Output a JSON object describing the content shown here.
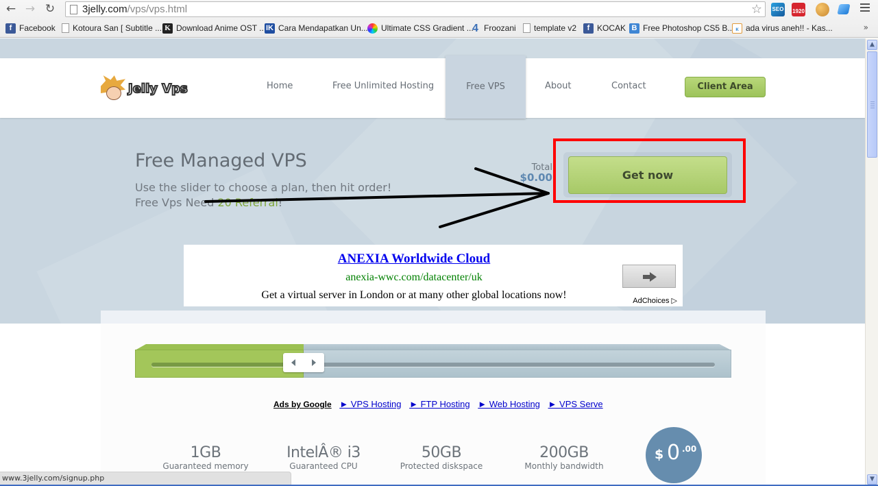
{
  "browser": {
    "url_host": "3jelly.com",
    "url_path": "/vps/vps.html",
    "bookmarks": [
      {
        "label": "Facebook",
        "icon": "facebook-icon"
      },
      {
        "label": "Kotoura San [ Subtitle ...",
        "icon": "page-icon"
      },
      {
        "label": "Download Anime OST ...",
        "icon": "k-site-icon"
      },
      {
        "label": "Cara Mendapatkan Un...",
        "icon": "ik-site-icon"
      },
      {
        "label": "Ultimate CSS Gradient ...",
        "icon": "color-wheel-icon"
      },
      {
        "label": "Froozani",
        "icon": "four-icon"
      },
      {
        "label": "template v2",
        "icon": "page-icon"
      },
      {
        "label": "KOCAK",
        "icon": "facebook-icon"
      },
      {
        "label": "Free Photoshop CS5 B...",
        "icon": "blogger-b-icon"
      },
      {
        "label": "ada virus aneh!! - Kas...",
        "icon": "forum-icon"
      }
    ],
    "more_bookmarks": "»",
    "extensions": {
      "seo": "SEO",
      "calendar": "1920"
    },
    "status_url": "www.3jelly.com/signup.php"
  },
  "header": {
    "logo_text": "Jelly Vps",
    "nav": [
      {
        "label": "Home",
        "active": false
      },
      {
        "label": "Free Unlimited Hosting",
        "active": false
      },
      {
        "label": "Free VPS",
        "active": true
      },
      {
        "label": "About",
        "active": false
      },
      {
        "label": "Contact",
        "active": false
      }
    ],
    "client_area": "Client Area"
  },
  "hero": {
    "title": "Free Managed VPS",
    "subtitle_line1": "Use the slider to choose a plan, then hit order!",
    "subtitle_line2_prefix": "Free Vps Need ",
    "subtitle_line2_highlight": "20 Referral",
    "subtitle_line2_suffix": "!",
    "total_label": "Total",
    "total_value": "$0.00",
    "cta": "Get now"
  },
  "ad_banner": {
    "title": "ANEXIA Worldwide Cloud",
    "url": "anexia-wwc.com/datacenter/uk",
    "description": "Get a virtual server in London or at many other global locations now!",
    "adchoices": "AdChoices"
  },
  "slider": {
    "value_fraction": 0.28
  },
  "text_ads": {
    "label": "Ads by Google",
    "links": [
      "► VPS Hosting",
      "► FTP Hosting",
      "► Web Hosting",
      "► VPS Serve"
    ]
  },
  "specs": [
    {
      "value": "1GB",
      "label": "Guaranteed memory"
    },
    {
      "value": "IntelÂ® i3",
      "label": "Guaranteed CPU"
    },
    {
      "value": "50GB",
      "label": "Protected diskspace"
    },
    {
      "value": "200GB",
      "label": "Monthly bandwidth"
    }
  ],
  "price": {
    "currency": "$",
    "integer": "0",
    "decimal": ".00"
  },
  "colors": {
    "accent_green": "#a3c65a",
    "price_blue": "#668dae",
    "annotation_red": "#ff0000"
  }
}
